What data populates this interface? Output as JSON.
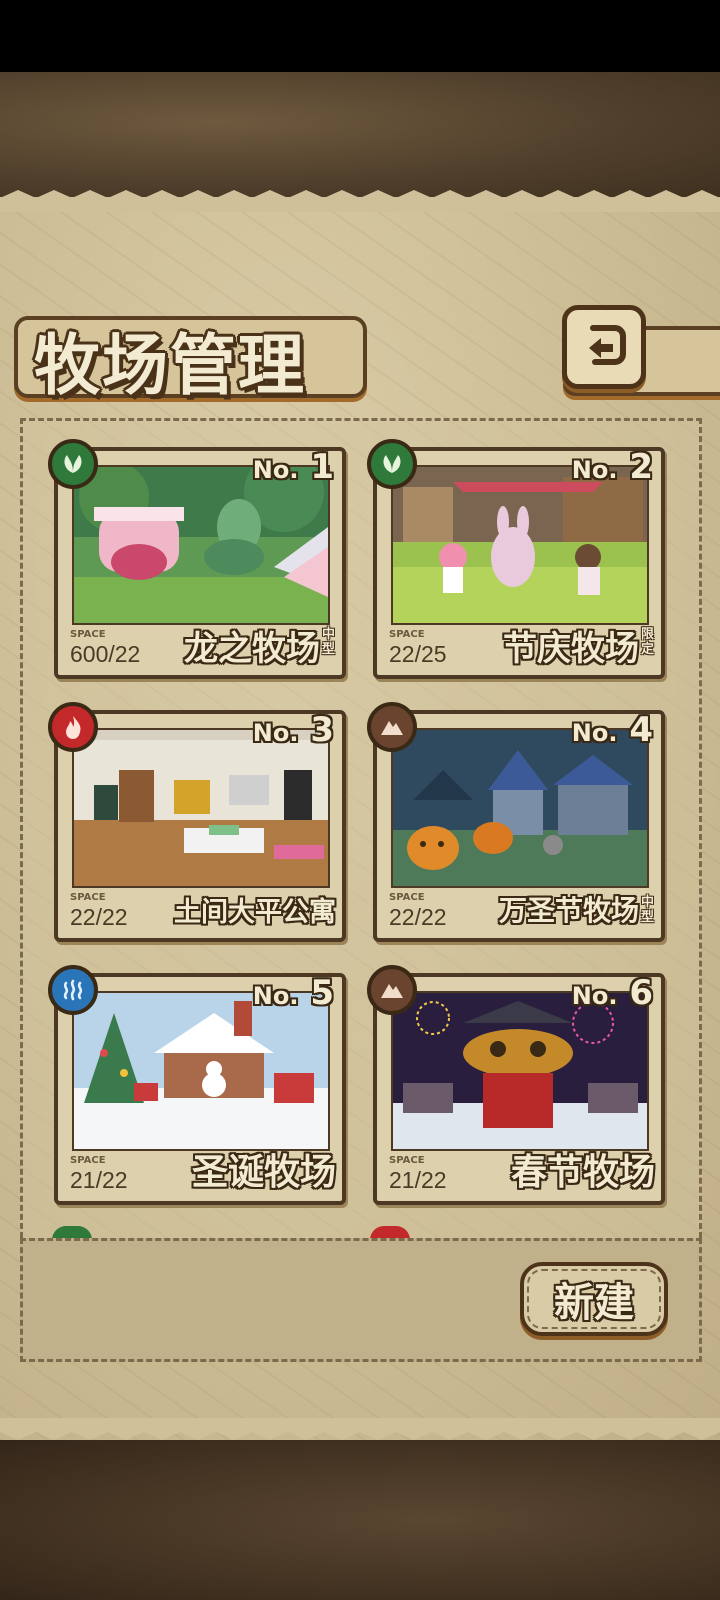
{
  "header": {
    "title": "牧场管理"
  },
  "buttons": {
    "new_label": "新建"
  },
  "ranches": [
    {
      "no_prefix": "No.",
      "number": "1",
      "space_label": "SPACE",
      "space": "600/22",
      "name": "龙之牧场",
      "tag": "中型",
      "element": "leaf"
    },
    {
      "no_prefix": "No.",
      "number": "2",
      "space_label": "SPACE",
      "space": "22/25",
      "name": "节庆牧场",
      "tag": "限定",
      "element": "leaf"
    },
    {
      "no_prefix": "No.",
      "number": "3",
      "space_label": "SPACE",
      "space": "22/22",
      "name": "土间大平公寓",
      "tag": "",
      "element": "fire"
    },
    {
      "no_prefix": "No.",
      "number": "4",
      "space_label": "SPACE",
      "space": "22/22",
      "name": "万圣节牧场",
      "tag": "中型",
      "element": "earth"
    },
    {
      "no_prefix": "No.",
      "number": "5",
      "space_label": "SPACE",
      "space": "21/22",
      "name": "圣诞牧场",
      "tag": "",
      "element": "water"
    },
    {
      "no_prefix": "No.",
      "number": "6",
      "space_label": "SPACE",
      "space": "21/22",
      "name": "春节牧场",
      "tag": "",
      "element": "earth"
    }
  ],
  "colors": {
    "leaf": "#2f7a3a",
    "fire": "#c3282a",
    "water": "#2a74b8",
    "earth": "#6b4430",
    "frame": "#4d3823",
    "parchment": "#cfc09a"
  }
}
